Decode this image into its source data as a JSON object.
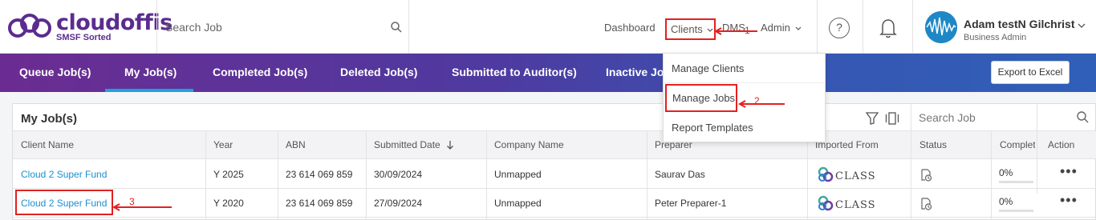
{
  "brand": {
    "name": "cloudoffis",
    "tagline": "SMSF Sorted"
  },
  "header": {
    "search_placeholder": "Search Job",
    "nav": {
      "dashboard": "Dashboard",
      "clients": "Clients",
      "dms": "DMS",
      "admin": "Admin"
    },
    "help_glyph": "?",
    "user": {
      "name": "Adam testN Gilchrist",
      "role": "Business Admin"
    }
  },
  "tabs": [
    {
      "label": "Queue Job(s)"
    },
    {
      "label": "My Job(s)",
      "active": true
    },
    {
      "label": "Completed Job(s)"
    },
    {
      "label": "Deleted Job(s)"
    },
    {
      "label": "Submitted to Auditor(s)"
    },
    {
      "label": "Inactive Job"
    }
  ],
  "export_label": "Export to Excel",
  "clients_menu": [
    "Manage Clients",
    "Manage Jobs",
    "Report Templates"
  ],
  "panel": {
    "title": "My Job(s)",
    "search_placeholder": "Search Job",
    "columns": [
      "Client Name",
      "Year",
      "ABN",
      "Submitted Date",
      "Company Name",
      "Preparer",
      "Imported From",
      "Status",
      "Complet",
      "Action"
    ],
    "rows": [
      {
        "client": "Cloud 2 Super Fund",
        "year": "Y 2025",
        "abn": "23 614 069 859",
        "submitted": "30/09/2024",
        "company": "Unmapped",
        "preparer": "Saurav Das",
        "imported": "CLASS",
        "complete": "0%"
      },
      {
        "client": "Cloud 2 Super Fund",
        "year": "Y 2020",
        "abn": "23 614 069 859",
        "submitted": "27/09/2024",
        "company": "Unmapped",
        "preparer": "Peter Preparer-1",
        "imported": "CLASS",
        "complete": "0%"
      }
    ]
  },
  "annotations": [
    "1",
    "2",
    "3"
  ],
  "colors": {
    "brand": "#5b2c8f",
    "link": "#1a8fd1",
    "annotation": "#e32020",
    "tab_indicator": "#1da1e0"
  }
}
